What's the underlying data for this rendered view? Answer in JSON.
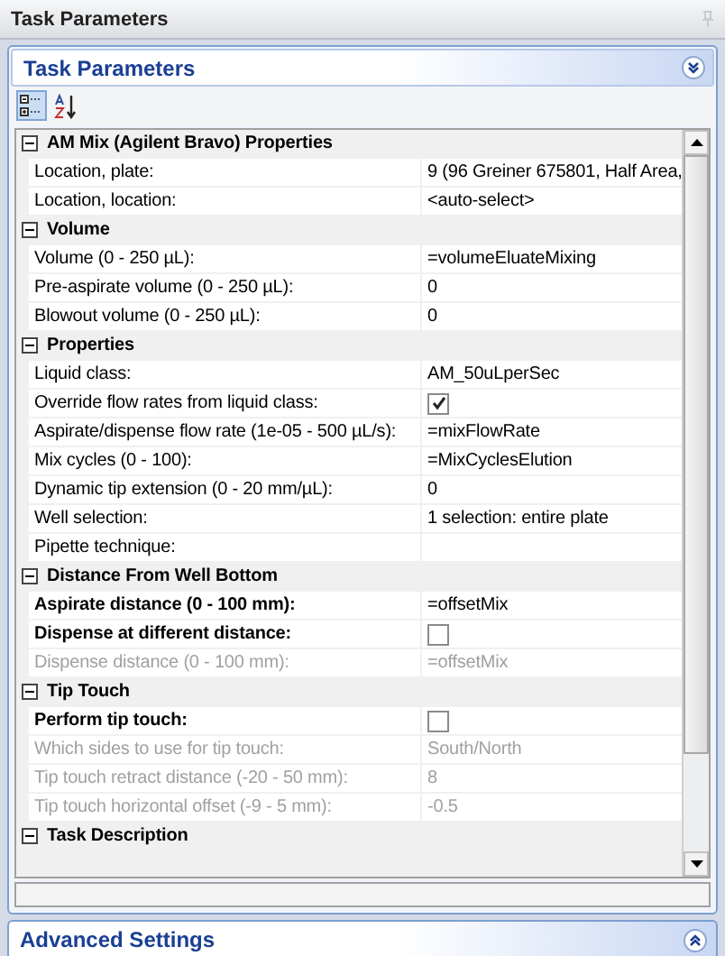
{
  "window": {
    "title": "Task Parameters"
  },
  "panel": {
    "title": "Task Parameters",
    "expanded": true
  },
  "toolbar": [
    {
      "kind": "categorized",
      "selected": true
    },
    {
      "kind": "alphabetical",
      "selected": false
    }
  ],
  "grid": {
    "categories": [
      {
        "name": "AM Mix (Agilent Bravo) Properties",
        "expanded": true,
        "properties": [
          {
            "name": "Location, plate:",
            "kind": "text",
            "value": "9  (96 Greiner 675801, Half Area,",
            "modified": false,
            "disabled": false
          },
          {
            "name": "Location, location:",
            "kind": "text",
            "value": "<auto-select>",
            "modified": false,
            "disabled": false
          }
        ]
      },
      {
        "name": "Volume",
        "expanded": true,
        "properties": [
          {
            "name": "Volume (0 - 250 µL):",
            "kind": "text",
            "value": "=volumeEluateMixing",
            "modified": false,
            "disabled": false
          },
          {
            "name": "Pre-aspirate volume (0 - 250 µL):",
            "kind": "text",
            "value": "0",
            "modified": false,
            "disabled": false
          },
          {
            "name": "Blowout volume (0 - 250 µL):",
            "kind": "text",
            "value": "0",
            "modified": false,
            "disabled": false
          }
        ]
      },
      {
        "name": "Properties",
        "expanded": true,
        "properties": [
          {
            "name": "Liquid class:",
            "kind": "text",
            "value": "AM_50uLperSec",
            "modified": false,
            "disabled": false
          },
          {
            "name": "Override flow rates from liquid class:",
            "kind": "checkbox",
            "checked": true,
            "modified": false,
            "disabled": false
          },
          {
            "name": "Aspirate/dispense flow rate (1e-05 - 500 µL/s):",
            "kind": "text",
            "value": "=mixFlowRate",
            "modified": false,
            "disabled": false
          },
          {
            "name": "Mix cycles (0 - 100):",
            "kind": "text",
            "value": "=MixCyclesElution",
            "modified": false,
            "disabled": false
          },
          {
            "name": "Dynamic tip extension (0 - 20 mm/µL):",
            "kind": "text",
            "value": "0",
            "modified": false,
            "disabled": false
          },
          {
            "name": "Well selection:",
            "kind": "text",
            "value": "1 selection: entire plate",
            "modified": false,
            "disabled": false
          },
          {
            "name": "Pipette technique:",
            "kind": "text",
            "modified": false,
            "disabled": false
          }
        ]
      },
      {
        "name": "Distance From Well Bottom",
        "expanded": true,
        "properties": [
          {
            "name": "Aspirate distance (0 - 100 mm):",
            "kind": "text",
            "value": "=offsetMix",
            "modified": true,
            "disabled": false
          },
          {
            "name": "Dispense at different distance:",
            "kind": "checkbox",
            "checked": false,
            "modified": true,
            "disabled": false
          },
          {
            "name": "Dispense distance (0 - 100 mm):",
            "kind": "text",
            "value": "=offsetMix",
            "modified": false,
            "disabled": true
          }
        ]
      },
      {
        "name": "Tip Touch",
        "expanded": true,
        "properties": [
          {
            "name": "Perform tip touch:",
            "kind": "checkbox",
            "checked": false,
            "modified": true,
            "disabled": false
          },
          {
            "name": "Which sides to use for tip touch:",
            "kind": "text",
            "value": "South/North",
            "modified": false,
            "disabled": true
          },
          {
            "name": "Tip touch retract distance (-20 - 50 mm):",
            "kind": "text",
            "value": "8",
            "modified": false,
            "disabled": true
          },
          {
            "name": "Tip touch horizontal offset (-9 - 5 mm):",
            "kind": "text",
            "value": "-0.5",
            "modified": false,
            "disabled": true
          }
        ]
      },
      {
        "name": "Task Description",
        "expanded": true
      }
    ]
  },
  "advanced": {
    "title": "Advanced Settings",
    "expanded": false
  }
}
